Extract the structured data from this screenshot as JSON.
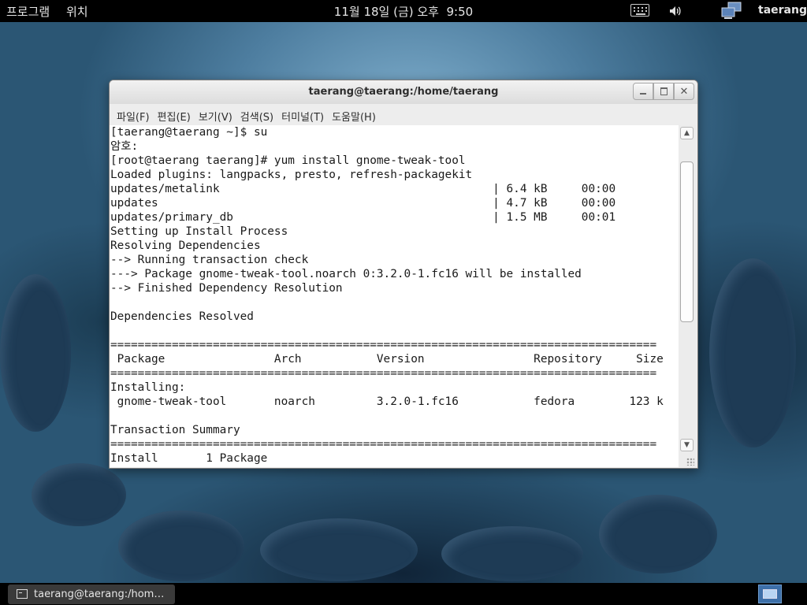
{
  "top_panel": {
    "applications": "프로그램",
    "places": "위치",
    "clock": "11월 18일 (금) 오후  9:50",
    "user": "taerang"
  },
  "window": {
    "title": "taerang@taerang:/home/taerang",
    "menu": [
      "파일(F)",
      "편집(E)",
      "보기(V)",
      "검색(S)",
      "터미널(T)",
      "도움말(H)"
    ],
    "terminal_lines": [
      "[taerang@taerang ~]$ su",
      "암호:",
      "[root@taerang taerang]# yum install gnome-tweak-tool",
      "Loaded plugins: langpacks, presto, refresh-packagekit",
      "updates/metalink                                        | 6.4 kB     00:00",
      "updates                                                 | 4.7 kB     00:00",
      "updates/primary_db                                      | 1.5 MB     00:01",
      "Setting up Install Process",
      "Resolving Dependencies",
      "--> Running transaction check",
      "---> Package gnome-tweak-tool.noarch 0:3.2.0-1.fc16 will be installed",
      "--> Finished Dependency Resolution",
      "",
      "Dependencies Resolved",
      "",
      "================================================================================",
      " Package                Arch           Version                Repository     Size",
      "================================================================================",
      "Installing:",
      " gnome-tweak-tool       noarch         3.2.0-1.fc16           fedora        123 k",
      "",
      "Transaction Summary",
      "================================================================================",
      "Install       1 Package"
    ]
  },
  "taskbar": {
    "task_label": "taerang@taerang:/hom…"
  }
}
